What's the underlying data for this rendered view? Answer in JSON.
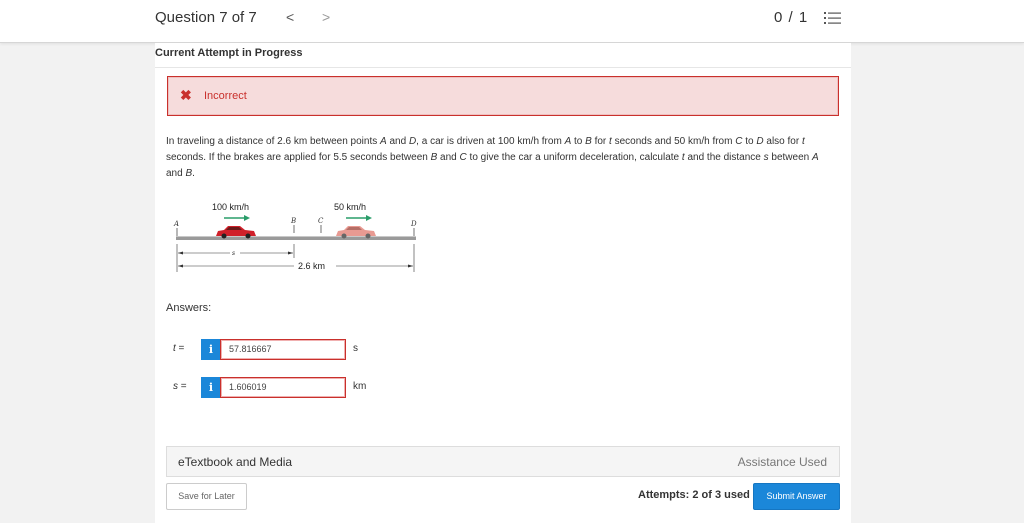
{
  "header": {
    "question_title": "Question 7 of 7",
    "prev_glyph": "<",
    "next_glyph": ">",
    "score": "0 / 1"
  },
  "attempt_label": "Current Attempt in Progress",
  "status": {
    "icon_glyph": "✖",
    "text": "Incorrect"
  },
  "problem": {
    "part1": "In traveling a distance of 2.6 km between points ",
    "point_a": "A",
    "and1": " and ",
    "point_d": "D",
    "part2": ", a car is driven at 100 km/h from ",
    "point_a2": "A",
    "to1": " to ",
    "point_b": "B",
    "for1": " for ",
    "t1": "t",
    "part3": " seconds and 50 km/h from ",
    "point_c": "C",
    "to2": " to ",
    "point_d2": "D",
    "part4": " also for ",
    "t2": "t",
    "part5": " seconds. If the brakes are applied for 5.5 seconds between ",
    "point_b2": "B",
    "and2": " and ",
    "point_c2": "C",
    "part6": " to give the car a uniform deceleration, calculate ",
    "t3": "t",
    "part7": " and the distance ",
    "s1": "s",
    "part8": " between ",
    "point_a3": "A",
    "and3": " and ",
    "point_b3": "B",
    "end": "."
  },
  "diagram": {
    "speed1": "100 km/h",
    "speed2": "50 km/h",
    "label_a": "A",
    "label_b": "B",
    "label_c": "C",
    "label_d": "D",
    "label_s": "s",
    "distance": "2.6 km",
    "car1_color": "#d0202a",
    "car2_color": "#e89a92",
    "arrow_color": "#2a9d6a"
  },
  "answers_label": "Answers:",
  "answers": [
    {
      "var": "t",
      "eq": " =",
      "info": "i",
      "value": "57.816667",
      "unit": "s"
    },
    {
      "var": "s",
      "eq": " =",
      "info": "i",
      "value": "1.606019",
      "unit": "km"
    }
  ],
  "media": {
    "label": "eTextbook and Media",
    "assistance": "Assistance Used"
  },
  "footer": {
    "save_label": "Save for Later",
    "attempts_text": "Attempts: 2 of 3 used",
    "submit_label": "Submit Answer"
  }
}
